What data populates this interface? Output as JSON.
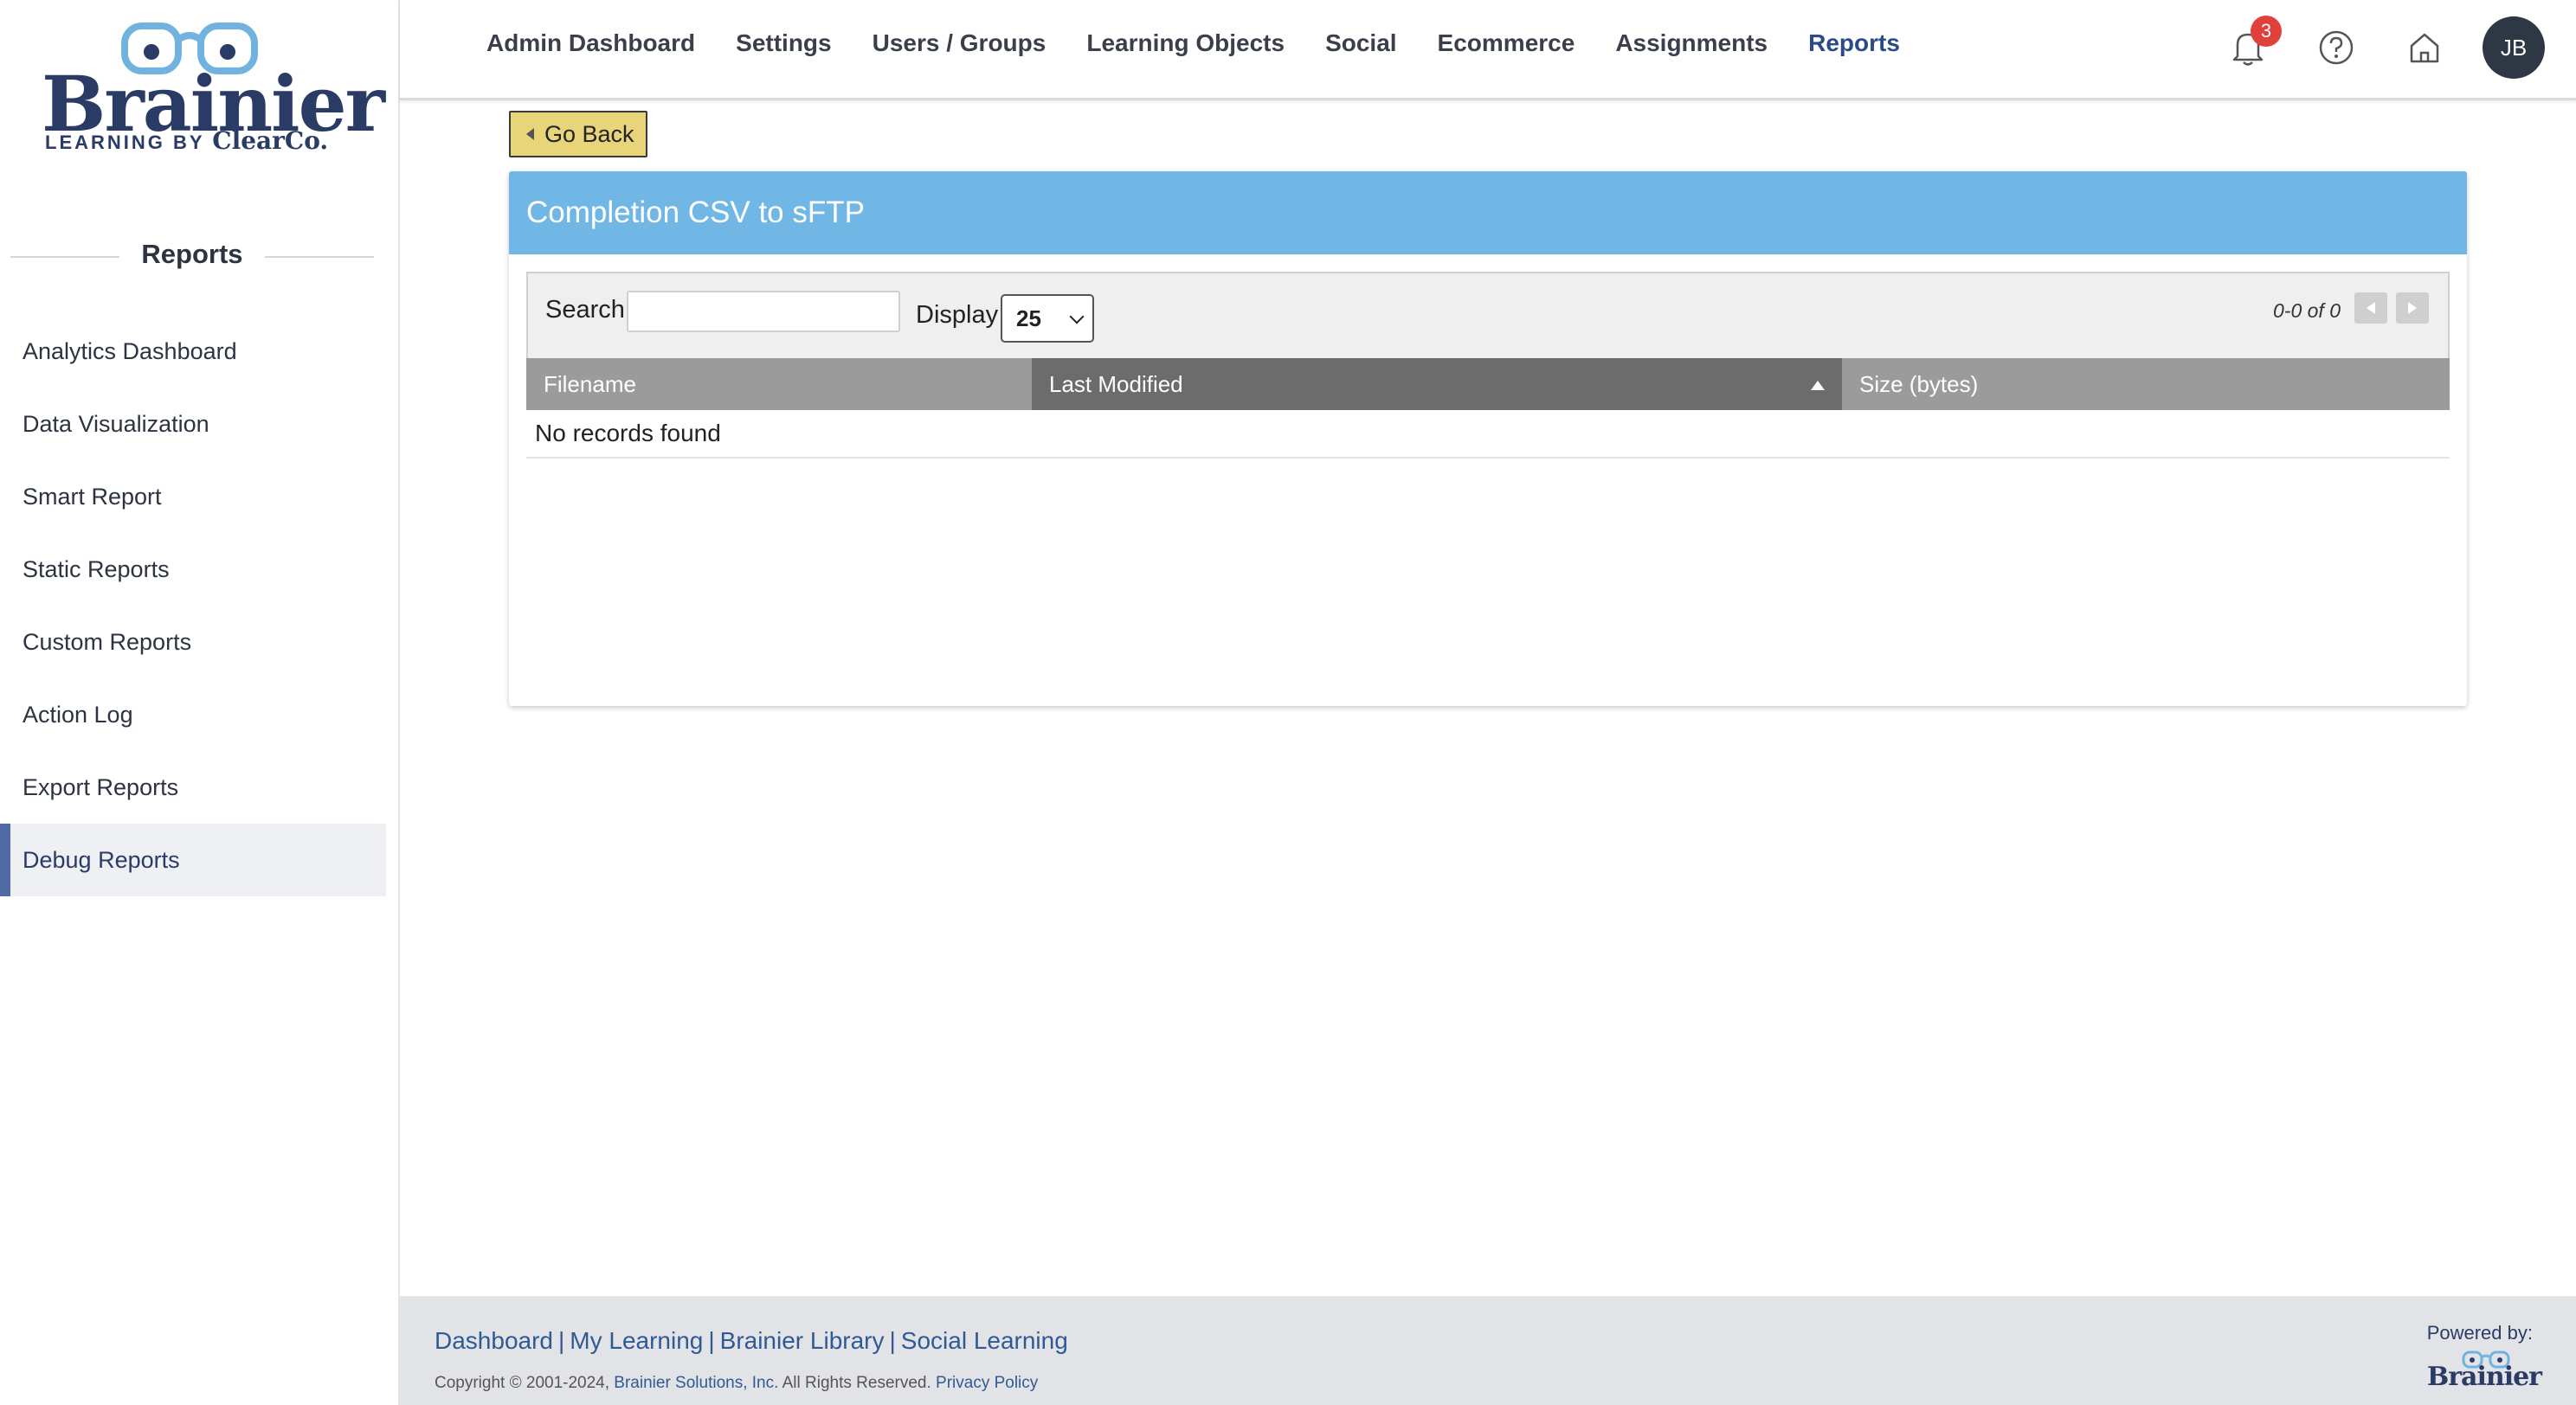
{
  "brand": {
    "logo_word": "Brainier",
    "logo_tagline": "LEARNING BY",
    "logo_tagline_brand": "ClearCo."
  },
  "sidebar": {
    "title": "Reports",
    "items": [
      {
        "label": "Analytics Dashboard"
      },
      {
        "label": "Data Visualization"
      },
      {
        "label": "Smart Report"
      },
      {
        "label": "Static Reports"
      },
      {
        "label": "Custom Reports"
      },
      {
        "label": "Action Log"
      },
      {
        "label": "Export Reports"
      },
      {
        "label": "Debug Reports",
        "active": true
      }
    ]
  },
  "nav": {
    "items": [
      {
        "label": "Admin Dashboard"
      },
      {
        "label": "Settings"
      },
      {
        "label": "Users / Groups"
      },
      {
        "label": "Learning Objects"
      },
      {
        "label": "Social"
      },
      {
        "label": "Ecommerce"
      },
      {
        "label": "Assignments"
      },
      {
        "label": "Reports",
        "active": true
      }
    ],
    "notification_count": "3",
    "icons": [
      "bell-icon",
      "help-icon",
      "home-icon"
    ],
    "avatar_initials": "JB"
  },
  "main": {
    "go_back_label": "Go Back",
    "panel_title": "Completion CSV to sFTP",
    "search_label": "Search",
    "search_value": "",
    "display_label": "Display",
    "display_value": "25",
    "page_info": "0-0 of 0",
    "columns": [
      "Filename",
      "Last Modified",
      "Size (bytes)"
    ],
    "sorted_column": "Last Modified",
    "sort_direction": "ascending",
    "empty_message": "No records found"
  },
  "footer": {
    "links": [
      "Dashboard",
      "My Learning",
      "Brainier Library",
      "Social Learning"
    ],
    "copyright_prefix": "Copyright © 2001-2024,",
    "company": "Brainier Solutions, Inc.",
    "rights": "All Rights Reserved.",
    "privacy": "Privacy Policy",
    "powered_by": "Powered by:",
    "powered_logo": "Brainier"
  },
  "colors": {
    "brand_navy": "#2a3b66",
    "panel_header": "#71b7e6",
    "go_back": "#e8d57a",
    "badge": "#e0413a",
    "active_nav": "#2a4a8a"
  }
}
